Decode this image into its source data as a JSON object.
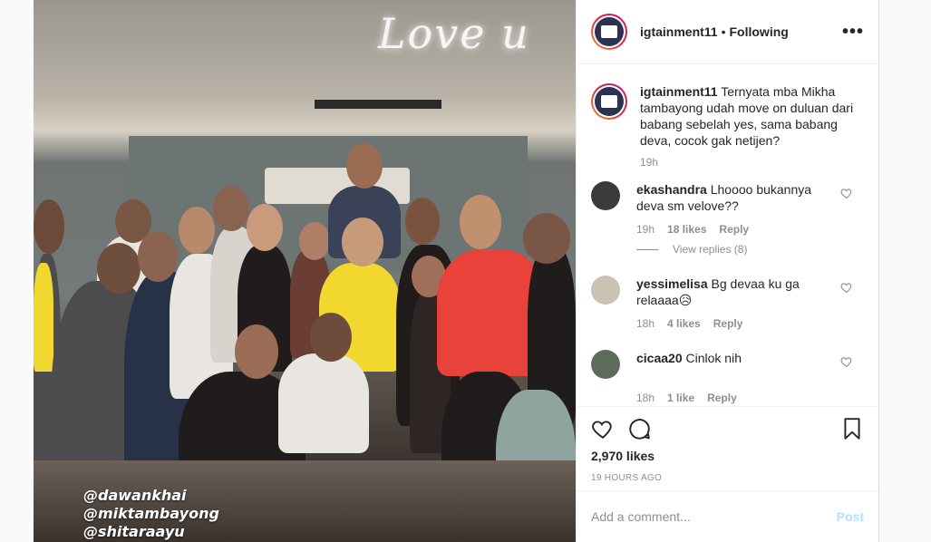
{
  "photo": {
    "neon_text": "Love u",
    "tags": [
      "@dawankhai",
      "@miktambayong",
      "@shitaraayu"
    ]
  },
  "header": {
    "username": "igtainment11",
    "separator": "•",
    "follow_status": "Following",
    "more_label": "•••"
  },
  "caption": {
    "username": "igtainment11",
    "text": "Ternyata mba Mikha tambayong udah move on duluan dari babang sebelah yes, sama babang deva, cocok gak netijen?",
    "time": "19h"
  },
  "comments": [
    {
      "username": "ekashandra",
      "text": "Lhoooo bukannya deva sm velove??",
      "time": "19h",
      "likes": "18 likes",
      "reply": "Reply",
      "view_replies": "View replies (8)",
      "avatar_color": "#3d3a3a"
    },
    {
      "username": "yessimelisa",
      "text": "Bg devaa ku ga relaaaa😥",
      "time": "18h",
      "likes": "4 likes",
      "reply": "Reply",
      "avatar_color": "#c9c2b5"
    },
    {
      "username": "cicaa20",
      "text": "Cinlok nih",
      "time": "18h",
      "likes": "1 like",
      "reply": "Reply",
      "avatar_color": "#5d6b5a"
    }
  ],
  "actions": {
    "likes_count": "2,970 likes",
    "time_ago": "19 HOURS AGO",
    "icons": [
      "heart-icon",
      "comment-icon",
      "bookmark-icon"
    ]
  },
  "add_comment": {
    "placeholder": "Add a comment...",
    "post_label": "Post"
  },
  "colors": {
    "post_disabled": "#b2dffc",
    "meta_grey": "#8e8e8e",
    "text": "#262626"
  }
}
